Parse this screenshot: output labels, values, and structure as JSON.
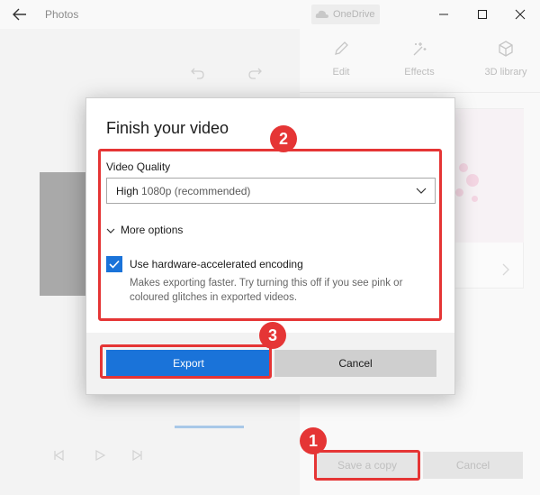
{
  "window": {
    "app_title": "Photos",
    "onedrive_label": "OneDrive"
  },
  "toolbar": {
    "edit_label": "Edit",
    "effects_label": "Effects",
    "library_label": "3D library"
  },
  "background_actions": {
    "save_copy_label": "Save a copy",
    "cancel_label": "Cancel"
  },
  "dialog": {
    "title": "Finish your video",
    "quality_label": "Video Quality",
    "quality_value": "High",
    "quality_detail": "1080p (recommended)",
    "more_options_label": "More options",
    "hw_encoding_label": "Use hardware-accelerated encoding",
    "hw_encoding_checked": true,
    "hw_encoding_desc": "Makes exporting faster. Try turning this off if you see pink or coloured glitches in exported videos.",
    "export_label": "Export",
    "cancel_label": "Cancel"
  },
  "annotations": {
    "badge_1": "1",
    "badge_2": "2",
    "badge_3": "3"
  },
  "colors": {
    "accent": "#1a73d9",
    "annotation_red": "#e53535"
  }
}
